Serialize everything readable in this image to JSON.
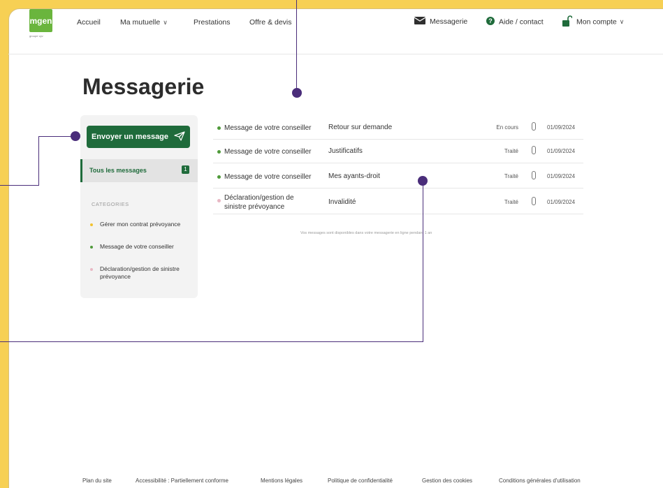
{
  "header": {
    "logo_text": "mgen",
    "logo_sub": "groupe vyv",
    "nav": [
      "Accueil",
      "Ma mutuelle",
      "Prestations",
      "Offre & devis"
    ],
    "messagerie_label": "Messagerie",
    "help_label": "Aide / contact",
    "account_label": "Mon compte"
  },
  "page_title": "Messagerie",
  "sidebar": {
    "send_button": "Envoyer un message",
    "all_messages": "Tous les messages",
    "all_messages_count": "1",
    "categories_heading": "CATEGORIES",
    "categories": [
      {
        "label": "Gérer mon contrat prévoyance",
        "color": "#f2c230"
      },
      {
        "label": "Message de votre conseiller",
        "color": "#4f9a3a"
      },
      {
        "label": "Déclaration/gestion de sinistre prévoyance",
        "color": "#e8b8c4"
      }
    ]
  },
  "messages": [
    {
      "sender": "Message de votre conseiller",
      "subject": "Retour sur demande",
      "status": "En cours",
      "date": "01/09/2024",
      "dot_color": "#4f9a3a"
    },
    {
      "sender": "Message de votre conseiller",
      "subject": "Justificatifs",
      "status": "Traité",
      "date": "01/09/2024",
      "dot_color": "#4f9a3a"
    },
    {
      "sender": "Message de votre conseiller",
      "subject": "Mes ayants-droit",
      "status": "Traité",
      "date": "01/09/2024",
      "dot_color": "#4f9a3a"
    },
    {
      "sender": "Déclaration/gestion de sinistre prévoyance",
      "subject": "Invalidité",
      "status": "Traité",
      "date": "01/09/2024",
      "dot_color": "#e8b8c4"
    }
  ],
  "retention_note": "Vos messages sont disponibles dans votre messagerie en ligne pendant 1 an",
  "footer": [
    "Plan du site",
    "Accessibilité : Partiellement conforme",
    "Mentions légales",
    "Politique de confidentialité",
    "Gestion des cookies",
    "Conditions générales d'utilisation"
  ],
  "colors": {
    "background": "#f7d054",
    "brand_green": "#1f6b3b",
    "logo_green": "#6ab53d",
    "annotation": "#4a2d7a"
  }
}
